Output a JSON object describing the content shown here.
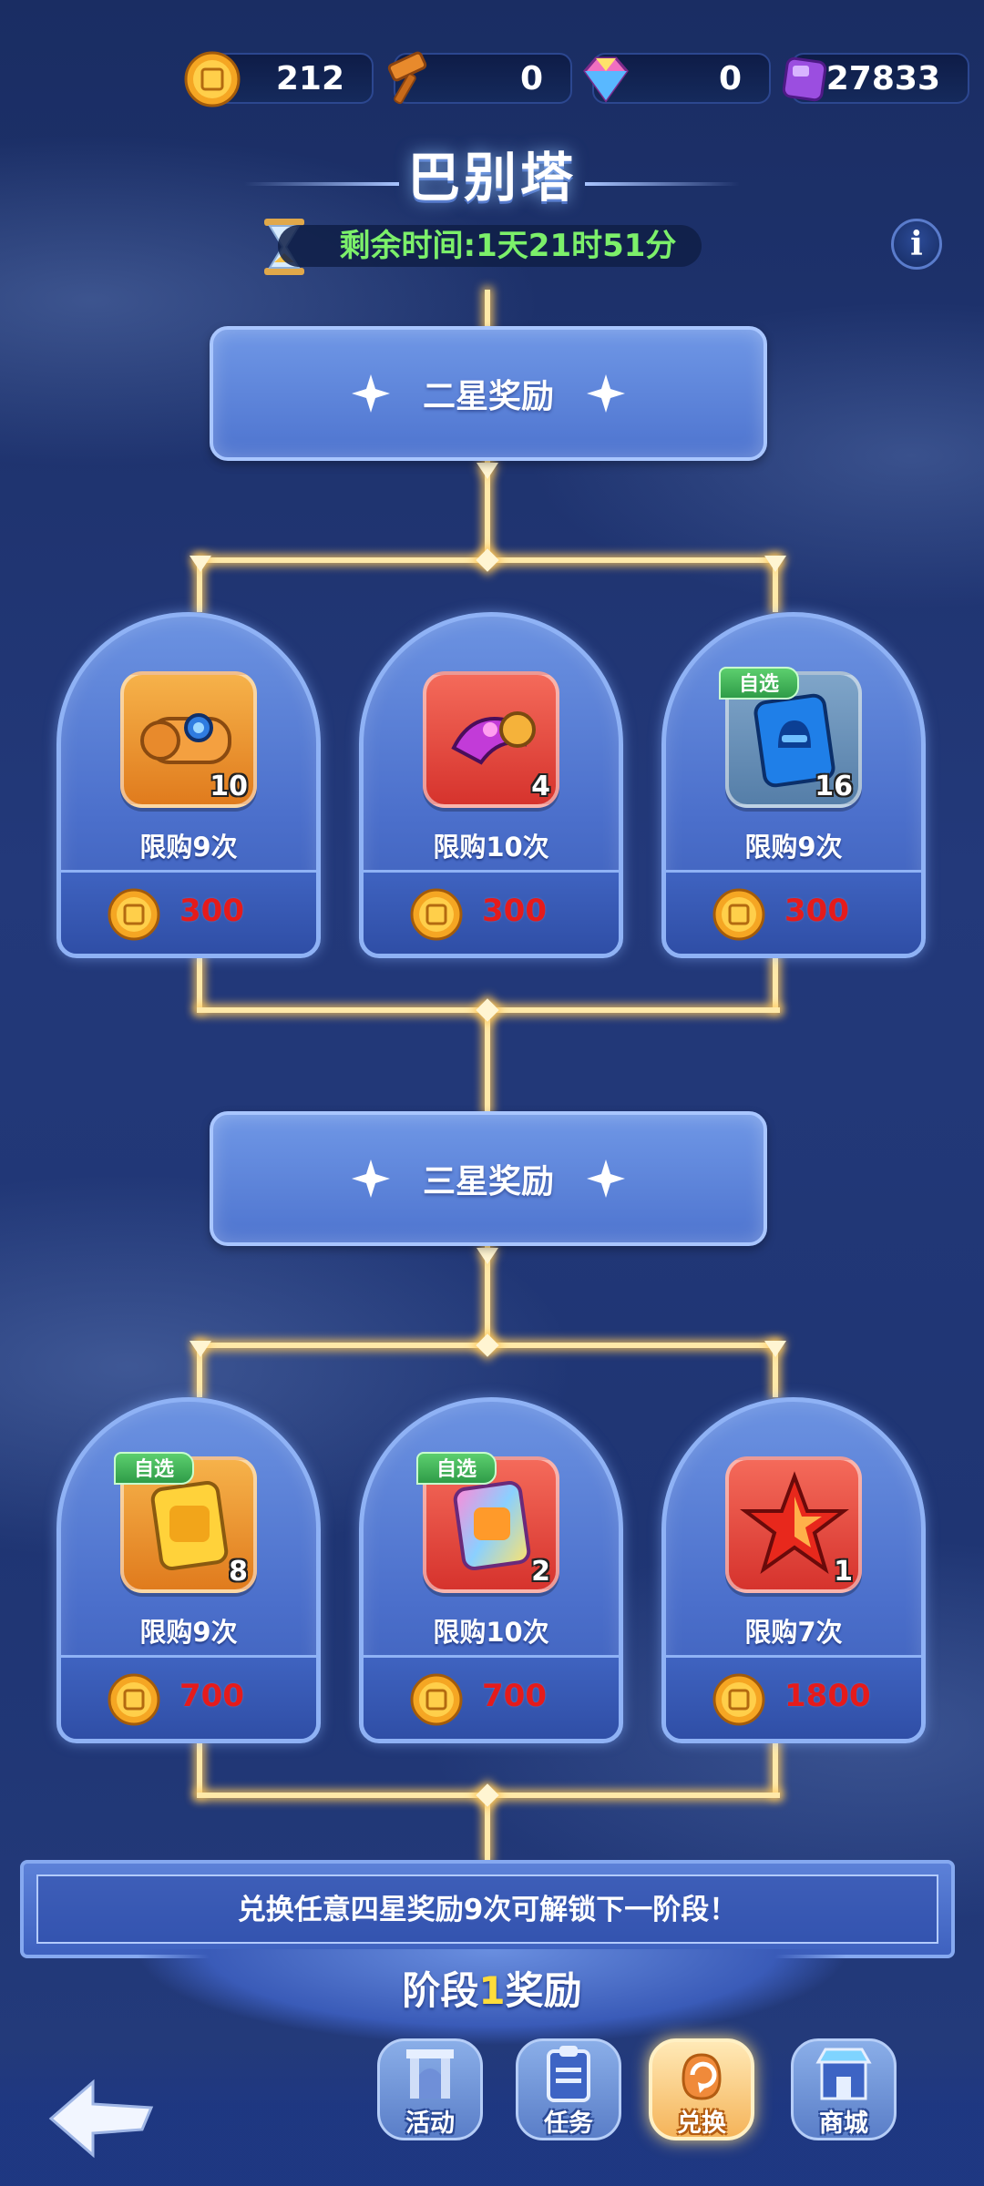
{
  "currencies": [
    {
      "name": "gold-coin",
      "value": "212"
    },
    {
      "name": "hammer",
      "value": "0"
    },
    {
      "name": "diamond",
      "value": "0"
    },
    {
      "name": "purple-gem",
      "value": "27833"
    }
  ],
  "title": "巴别塔",
  "timer": "剩余时间:1天21时51分",
  "info_label": "i",
  "tiers": [
    {
      "label": "二星奖励",
      "rewards": [
        {
          "icon": "scroll-icon",
          "count": "10",
          "limit": "限购9次",
          "price": "300",
          "self_select": ""
        },
        {
          "icon": "magic-horn-icon",
          "count": "4",
          "limit": "限购10次",
          "price": "300",
          "self_select": ""
        },
        {
          "icon": "blue-card-icon",
          "count": "16",
          "limit": "限购9次",
          "price": "300",
          "self_select": "自选"
        }
      ]
    },
    {
      "label": "三星奖励",
      "rewards": [
        {
          "icon": "gold-card-icon",
          "count": "8",
          "limit": "限购9次",
          "price": "700",
          "self_select": "自选"
        },
        {
          "icon": "rainbow-card-icon",
          "count": "2",
          "limit": "限购10次",
          "price": "700",
          "self_select": "自选"
        },
        {
          "icon": "red-star-icon",
          "count": "1",
          "limit": "限购7次",
          "price": "1800",
          "self_select": ""
        }
      ]
    }
  ],
  "unlock_message": "兑换任意四星奖励9次可解锁下一阶段！",
  "stage": {
    "prefix": "阶段",
    "number": "1",
    "suffix": "奖励"
  },
  "nav": [
    {
      "label": "活动",
      "icon": "gate-icon"
    },
    {
      "label": "任务",
      "icon": "clipboard-icon"
    },
    {
      "label": "兑换",
      "icon": "exchange-icon",
      "active": true
    },
    {
      "label": "商城",
      "icon": "shop-icon"
    }
  ],
  "colors": {
    "accent_gold": "#ffe9a8",
    "price_red": "#e51b1b",
    "timer_green": "#7cf06a"
  }
}
